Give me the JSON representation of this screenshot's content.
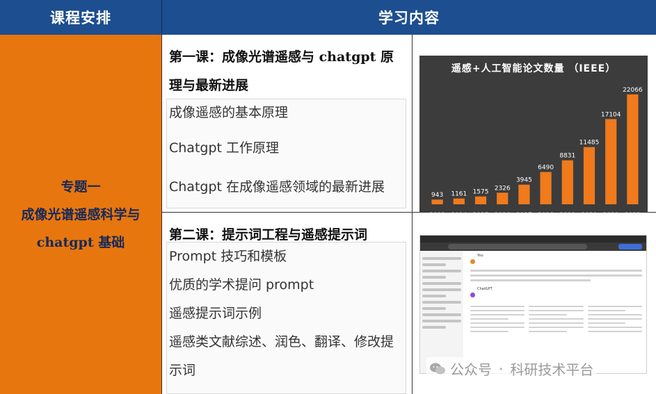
{
  "header": {
    "col1": "课程安排",
    "col2": "学习内容"
  },
  "topic": {
    "line1": "专题一",
    "line2": "成像光谱遥感科学与",
    "line3": "chatgpt 基础"
  },
  "lesson1": {
    "title": "第一课：成像光谱遥感与 chatgpt 原理与最新进展",
    "items": [
      "成像遥感的基本原理",
      "Chatgpt 工作原理",
      "Chatgpt 在成像遥感领域的最新进展"
    ]
  },
  "lesson2": {
    "title": "第二课：提示词工程与遥感提示词",
    "items": [
      "Prompt 技巧和模板",
      "优质的学术提问 prompt",
      "遥感提示词示例",
      "遥感类文献综述、润色、翻译、修改提示词"
    ]
  },
  "chart_data": {
    "type": "bar",
    "title": "遥感+人工智能论文数量 （IEEE）",
    "categories": [
      "2013",
      "2014",
      "2015",
      "2016",
      "2017",
      "2018",
      "2019",
      "2020",
      "2021",
      "2022"
    ],
    "values": [
      943,
      1161,
      1575,
      2326,
      3945,
      6490,
      8831,
      11485,
      17104,
      22066
    ],
    "ylim": [
      0,
      24000
    ],
    "bar_color": "#f07a1c",
    "background": "#3c3c3c"
  },
  "screenshot": {
    "app_title": "ChatGPT",
    "user": "You",
    "assistant": "ChatGPT"
  },
  "watermark": {
    "left": "公众号",
    "sep": "·",
    "right": "科研技术平台",
    "icon": "wechat-icon"
  },
  "colors": {
    "header_bg": "#1d4e8f",
    "topic_bg": "#e8760e",
    "accent": "#f07a1c"
  }
}
